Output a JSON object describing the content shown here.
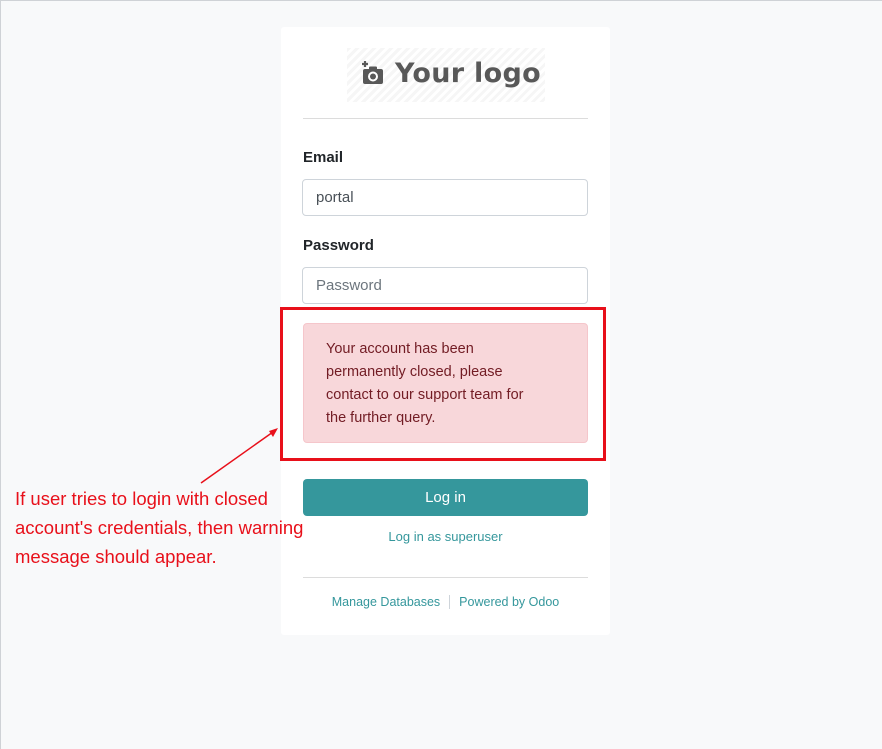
{
  "logo": {
    "text": "Your logo",
    "icon": "camera-plus-icon"
  },
  "form": {
    "email_label": "Email",
    "email_value": "portal",
    "password_label": "Password",
    "password_placeholder": "Password"
  },
  "alert": {
    "message": "Your account has been permanently closed, please contact to our support team for the further query."
  },
  "actions": {
    "login_label": "Log in",
    "superuser_label": "Log in as superuser"
  },
  "footer": {
    "manage_databases": "Manage Databases",
    "powered_by": "Powered by Odoo"
  },
  "annotation": {
    "text": "If user tries to login with closed account's credentials, then warning message should appear."
  },
  "colors": {
    "primary": "#35979c",
    "alert_bg": "#f8d7da",
    "alert_text": "#721c24",
    "annotation": "#e8101a"
  }
}
